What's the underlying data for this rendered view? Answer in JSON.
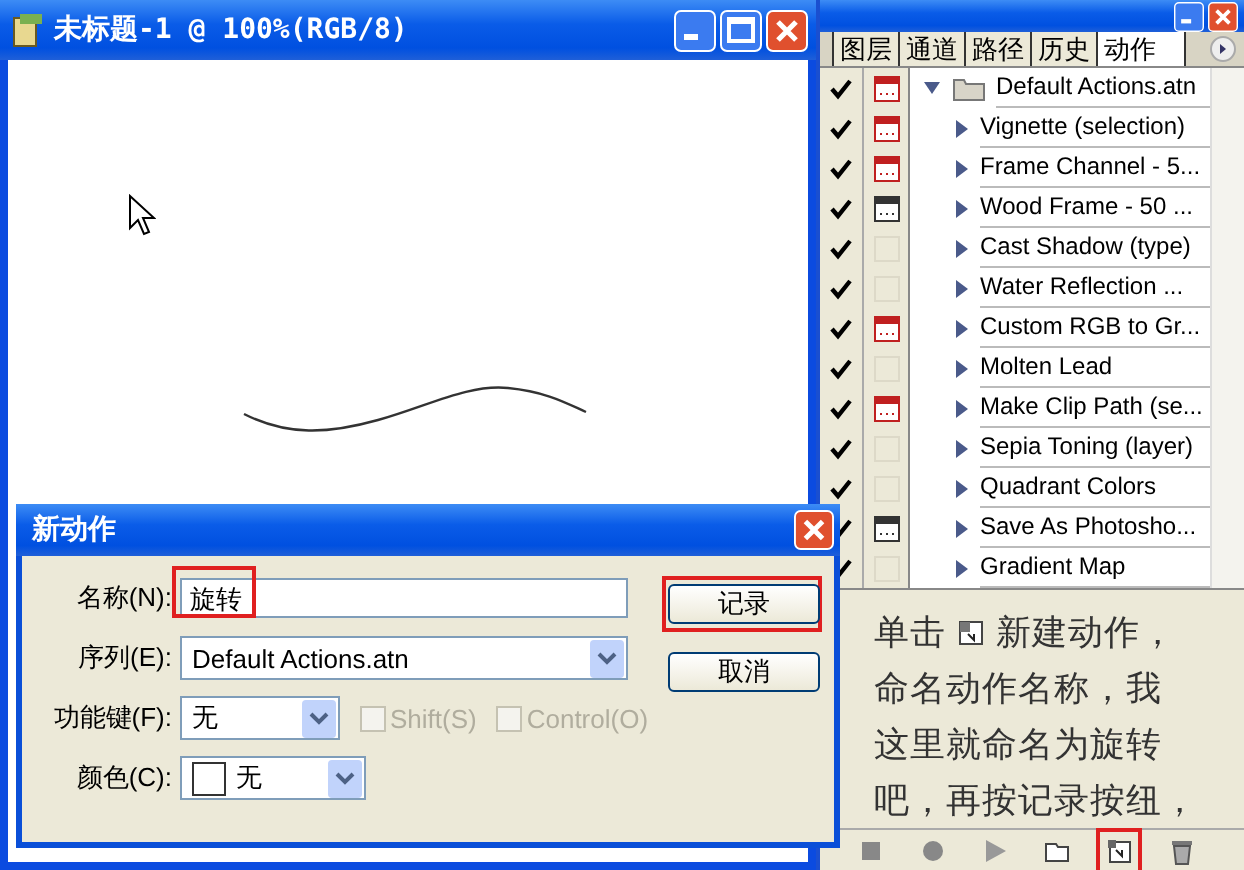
{
  "document_window": {
    "title": "未标题-1 @ 100%(RGB/8)"
  },
  "actions_panel": {
    "tabs": [
      {
        "label": "图层",
        "selected": false
      },
      {
        "label": "通道",
        "selected": false
      },
      {
        "label": "路径",
        "selected": false
      },
      {
        "label": "历史",
        "selected": false
      },
      {
        "label": "动作",
        "selected": true
      }
    ],
    "sets": [
      {
        "name": "Default Actions.atn",
        "checked": true,
        "dialog_on": true,
        "dialog_partial": true,
        "expanded": true,
        "children": [
          {
            "name": "Vignette (selection)",
            "checked": true,
            "dialog_on": true,
            "dialog_partial": true
          },
          {
            "name": "Frame Channel - 5...",
            "checked": true,
            "dialog_on": true,
            "dialog_partial": true
          },
          {
            "name": "Wood Frame - 50 ...",
            "checked": true,
            "dialog_on": true,
            "dialog_partial": false
          },
          {
            "name": "Cast Shadow (type)",
            "checked": true,
            "dialog_on": false
          },
          {
            "name": "Water Reflection ...",
            "checked": true,
            "dialog_on": false
          },
          {
            "name": "Custom RGB to Gr...",
            "checked": true,
            "dialog_on": true,
            "dialog_partial": true
          },
          {
            "name": "Molten Lead",
            "checked": true,
            "dialog_on": false
          },
          {
            "name": "Make Clip Path (se...",
            "checked": true,
            "dialog_on": true,
            "dialog_partial": true
          },
          {
            "name": "Sepia Toning (layer)",
            "checked": true,
            "dialog_on": false
          },
          {
            "name": "Quadrant Colors",
            "checked": true,
            "dialog_on": false
          },
          {
            "name": "Save As Photosho...",
            "checked": true,
            "dialog_on": true,
            "dialog_partial": false
          },
          {
            "name": "Gradient Map",
            "checked": true,
            "dialog_on": false
          }
        ]
      }
    ],
    "note": {
      "before_icon": "单击",
      "lines": [
        "新建动作，",
        "命名动作名称，我",
        "这里就命名为旋转",
        "吧，再按记录按纽，"
      ]
    },
    "toolbar": [
      {
        "kind": "stop",
        "highlighted": false
      },
      {
        "kind": "record",
        "highlighted": false
      },
      {
        "kind": "play",
        "highlighted": false
      },
      {
        "kind": "new-set",
        "highlighted": false
      },
      {
        "kind": "new-action",
        "highlighted": true
      },
      {
        "kind": "trash",
        "highlighted": false
      }
    ]
  },
  "dialog": {
    "title": "新动作",
    "fields": [
      {
        "kind": "text",
        "label": "名称(N):",
        "value": "旋转",
        "highlighted": true
      },
      {
        "kind": "select",
        "label": "序列(E):",
        "value": "Default Actions.atn"
      },
      {
        "kind": "function_key",
        "label": "功能键(F):",
        "value": "无",
        "options": [
          {
            "label": "Shift(S)",
            "checked": false,
            "disabled": true
          },
          {
            "label": "Control(O)",
            "checked": false,
            "disabled": true
          }
        ]
      },
      {
        "kind": "color",
        "label": "颜色(C):",
        "value": "无"
      }
    ],
    "buttons": [
      {
        "label": "记录",
        "highlighted": true
      },
      {
        "label": "取消",
        "highlighted": false
      }
    ]
  }
}
